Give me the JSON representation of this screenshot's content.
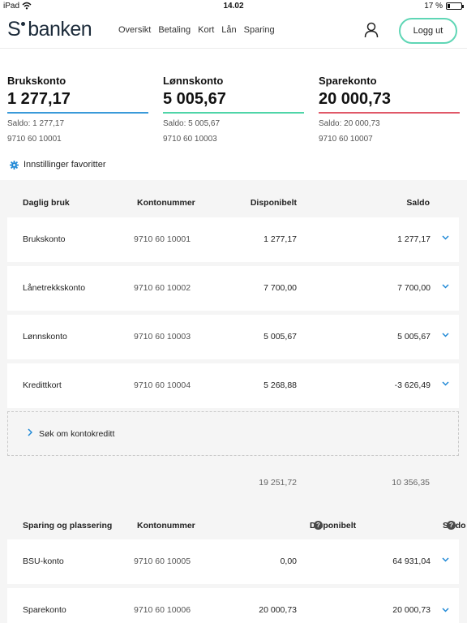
{
  "status_bar": {
    "device": "iPad",
    "time": "14.02",
    "battery": "17 %",
    "battery_level": 0.17
  },
  "header": {
    "logo": "banken",
    "nav": [
      "Oversikt",
      "Betaling",
      "Kort",
      "Lån",
      "Sparing"
    ],
    "logout": "Logg ut",
    "icons": {
      "user": "user-icon",
      "wifi": "wifi-icon"
    }
  },
  "favorites": [
    {
      "name": "Brukskonto",
      "amount": "1 277,17",
      "saldo": "Saldo: 1 277,17",
      "account": "9710 60 10001",
      "color": "#3a9ad9"
    },
    {
      "name": "Lønnskonto",
      "amount": "5 005,67",
      "saldo": "Saldo: 5 005,67",
      "account": "9710 60 10003",
      "color": "#4fd5a8"
    },
    {
      "name": "Sparekonto",
      "amount": "20 000,73",
      "saldo": "Saldo: 20 000,73",
      "account": "9710 60 10007",
      "color": "#e05868"
    }
  ],
  "settings_link": "Innstillinger favoritter",
  "daily": {
    "headers": {
      "name": "Daglig bruk",
      "account": "Kontonummer",
      "available": "Disponibelt",
      "balance": "Saldo"
    },
    "rows": [
      {
        "name": "Brukskonto",
        "account": "9710 60 10001",
        "available": "1 277,17",
        "balance": "1 277,17"
      },
      {
        "name": "Lånetrekkskonto",
        "account": "9710 60 10002",
        "available": "7 700,00",
        "balance": "7 700,00"
      },
      {
        "name": "Lønnskonto",
        "account": "9710 60 10003",
        "available": "5 005,67",
        "balance": "5 005,67"
      },
      {
        "name": "Kredittkort",
        "account": "9710 60 10004",
        "available": "5 268,88",
        "balance": "-3 626,49"
      }
    ],
    "apply_credit": "Søk om kontokreditt",
    "total_available": "19 251,72",
    "total_balance": "10 356,35"
  },
  "savings": {
    "headers": {
      "name": "Sparing og plassering",
      "account": "Kontonummer",
      "available": "Disponibelt",
      "balance": "Saldo"
    },
    "rows": [
      {
        "name": "BSU-konto",
        "account": "9710 60 10005",
        "available": "0,00",
        "balance": "64 931,04"
      },
      {
        "name": "Sparekonto",
        "account": "9710 60 10006",
        "available": "20 000,73",
        "balance": "20 000,73"
      }
    ]
  },
  "colors": {
    "accent": "#1e88d6",
    "logout_border": "#5fd6b5"
  }
}
